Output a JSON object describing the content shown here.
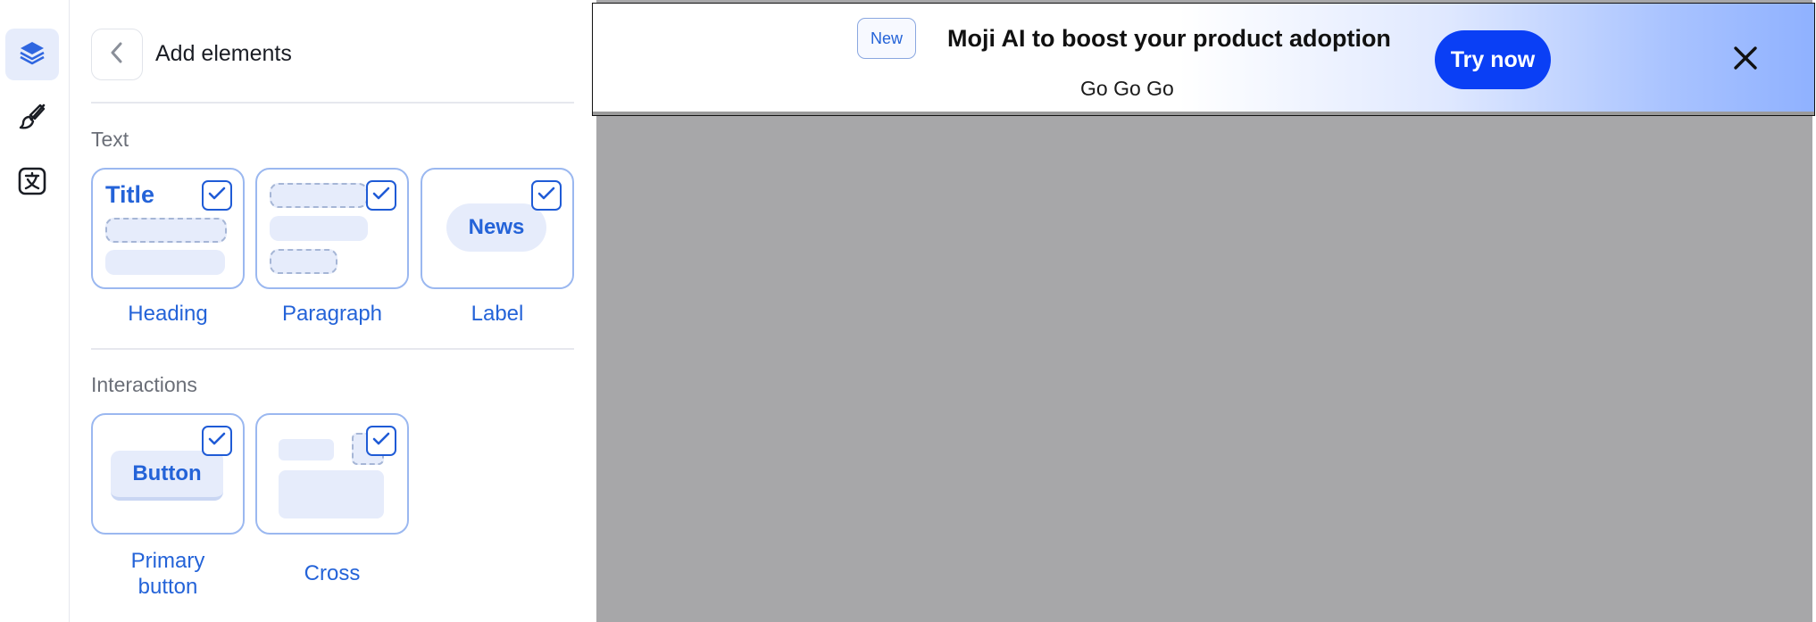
{
  "panel": {
    "title": "Add elements",
    "sections": [
      {
        "label": "Text",
        "items": [
          {
            "caption": "Heading",
            "preview_text": "Title",
            "checked": true
          },
          {
            "caption": "Paragraph",
            "checked": true
          },
          {
            "caption": "Label",
            "preview_text": "News",
            "checked": true
          }
        ]
      },
      {
        "label": "Interactions",
        "items": [
          {
            "caption_line1": "Primary",
            "caption_line2": "button",
            "preview_text": "Button",
            "checked": true
          },
          {
            "caption": "Cross",
            "checked": true
          }
        ]
      }
    ]
  },
  "rail": {
    "items": [
      "layers-icon",
      "brush-icon",
      "translate-icon"
    ],
    "active": "layers-icon"
  },
  "banner": {
    "badge": "New",
    "headline": "Moji AI to boost your product adoption",
    "subtext": "Go Go Go",
    "cta": "Try now"
  },
  "colors": {
    "accent": "#2463d8",
    "cta_bg": "#0a3ff5",
    "canvas_bg": "#a7a7a9",
    "card_border": "#9bb8f0",
    "placeholder": "#e6ecfb"
  }
}
